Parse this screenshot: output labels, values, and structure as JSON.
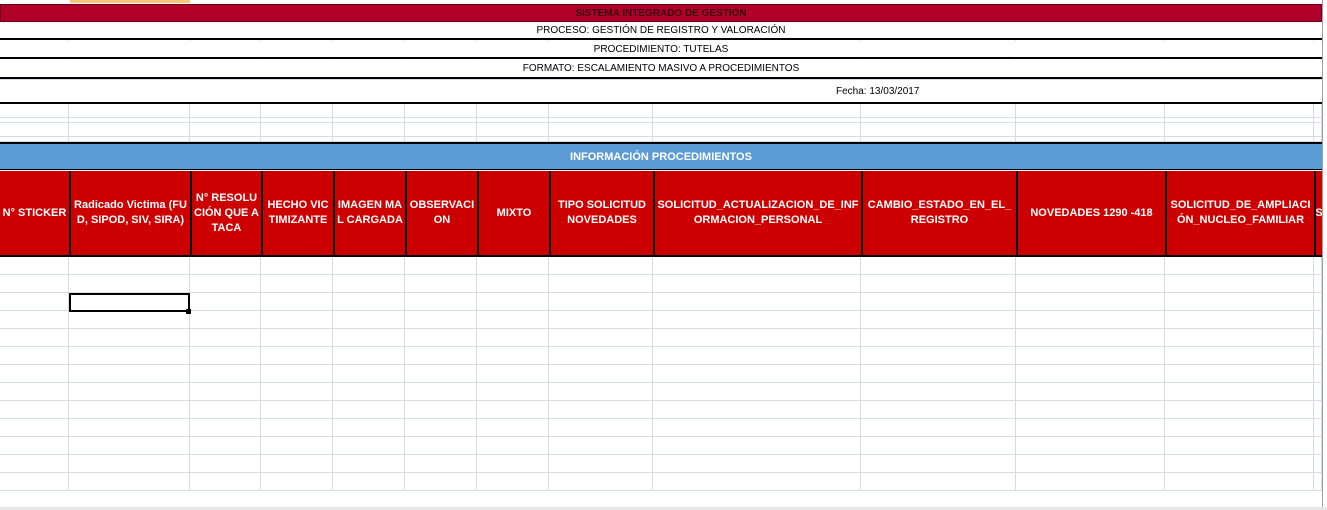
{
  "sheet": {
    "title": "SISTEMA INTEGRADO DE GESTION",
    "proceso": "PROCESO:  GESTIÓN DE REGISTRO Y VALORACIÓN",
    "procedimiento": "PROCEDIMIENTO: TUTELAS",
    "formato": "FORMATO: ESCALAMIENTO MASIVO A PROCEDIMIENTOS",
    "fecha": "Fecha:  13/03/2017",
    "section_title": "INFORMACIÓN PROCEDIMIENTOS",
    "columns": [
      "N° STICKER",
      "Radicado Victima (FUD, SIPOD, SIV, SIRA)",
      "N° RESOLUCIÓN QUE ATACA",
      "HECHO VICTIMIZANTE",
      "IMAGEN MAL CARGADA",
      "OBSERVACION",
      "MIXTO",
      "TIPO SOLICITUD NOVEDADES",
      "SOLICITUD_ACTUALIZACION_DE_INFORMACION_PERSONAL",
      "CAMBIO_ESTADO_EN_EL_REGISTRO",
      "NOVEDADES 1290 -418",
      "SOLICITUD_DE_AMPLIACIÓN_NUCLEO_FAMILIAR",
      "S"
    ]
  },
  "colors": {
    "title_band": "#b0002a",
    "header_red": "#cc0000",
    "section_blue": "#5b9bd5",
    "gridline": "#d6dce5",
    "active_column": "#f7c67a"
  }
}
